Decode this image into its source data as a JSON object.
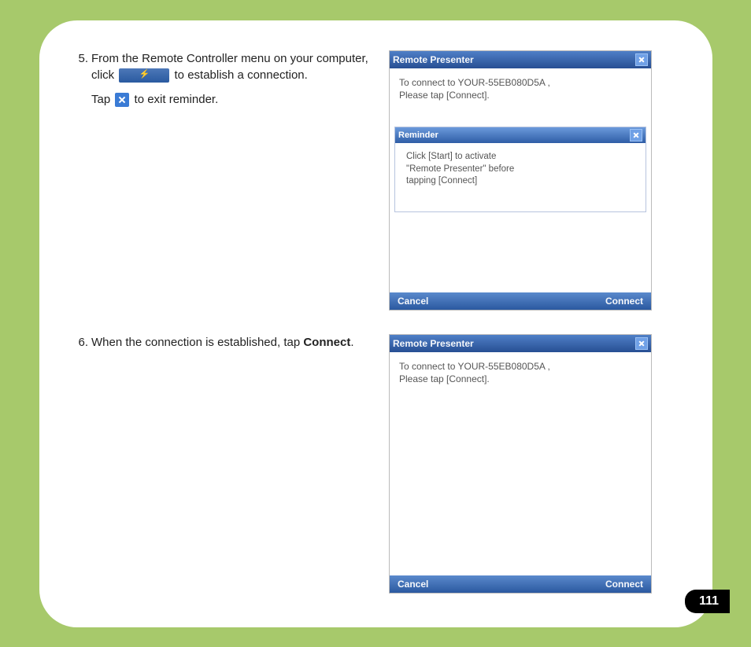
{
  "steps": {
    "s5": {
      "num": "5.",
      "line1a": "From the Remote Controller menu on your computer, click",
      "line1b": "to establish a connection.",
      "line2a": "Tap",
      "line2b": "to exit reminder."
    },
    "s6": {
      "num": "6.",
      "line1a": "When the connection is established, tap ",
      "bold": "Connect",
      "line1b": "."
    }
  },
  "shots": {
    "shot1": {
      "title": "Remote Presenter",
      "body1": "To connect to YOUR-55EB080D5A ,",
      "body2": "Please tap [Connect].",
      "reminder_title": "Reminder",
      "reminder_body1": "Click [Start] to activate",
      "reminder_body2": "\"Remote Presenter\" before",
      "reminder_body3": "tapping [Connect]",
      "cancel": "Cancel",
      "connect": "Connect"
    },
    "shot2": {
      "title": "Remote Presenter",
      "body1": "To connect to YOUR-55EB080D5A ,",
      "body2": "Please tap [Connect].",
      "cancel": "Cancel",
      "connect": "Connect"
    }
  },
  "page_number": "111"
}
